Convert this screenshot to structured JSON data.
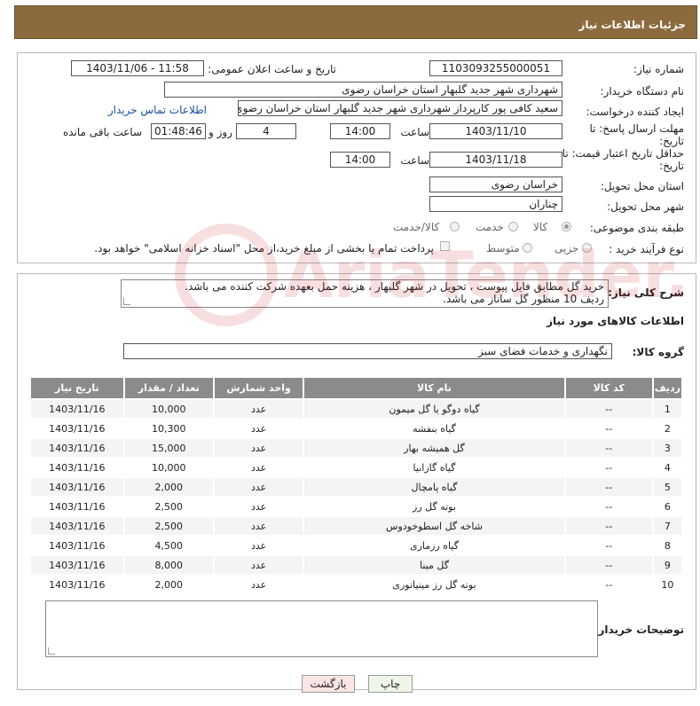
{
  "header": {
    "title": "جزئیات اطلاعات نیاز"
  },
  "form": {
    "need_number_label": "شماره نیاز:",
    "need_number": "1103093255000051",
    "announce_label": "تاریخ و ساعت اعلان عمومی:",
    "announce_value": "1403/11/06 - 11:58",
    "buyer_org_label": "نام دستگاه خریدار:",
    "buyer_org": "شهرداری شهر جدید گلبهار استان خراسان رضوی",
    "creator_label": "ایجاد کننده درخواست:",
    "creator": "سعید کافی پور کارپرداز شهرداری شهر جدید گلبهار استان خراسان رضوی",
    "contact_link": "اطلاعات تماس خریدار",
    "deadline_label": "مهلت ارسال پاسخ: تا تاریخ:",
    "deadline_date": "1403/11/10",
    "time_label": "ساعت",
    "deadline_time": "14:00",
    "days_value": "4",
    "days_label": "روز و",
    "remaining_time": "01:48:46",
    "remaining_label": "ساعت باقی مانده",
    "validity_label": "حداقل تاریخ اعتبار قیمت: تا تاریخ:",
    "validity_date": "1403/11/18",
    "validity_time": "14:00",
    "province_label": "استان محل تحویل:",
    "province": "خراسان رضوی",
    "city_label": "شهر محل تحویل:",
    "city": "چناران",
    "category_label": "طبقه بندی موضوعی:",
    "category_options": [
      "کالا",
      "خدمت",
      "کالا/خدمت"
    ],
    "process_label": "نوع فرآیند خرید :",
    "process_options": [
      "جزیی",
      "متوسط"
    ],
    "payment_note": "پرداخت تمام یا بخشی از مبلغ خرید،از محل \"اسناد خزانه اسلامی\" خواهد بود."
  },
  "description": {
    "label": "شرح کلی نیاز:",
    "line1": "خرید گل مطابق فایل پیوست ، تحویل در شهر گلبهار ، هزینه حمل بعهده شرکت کننده می باشد.",
    "line2": "ردیف 10 منظور گل ساناز می باشد."
  },
  "goods": {
    "section_title": "اطلاعات کالاهای مورد نیاز",
    "group_label": "گروه کالا:",
    "group_value": "نگهداری و خدمات فضای سبز",
    "columns": [
      "ردیف",
      "کد کالا",
      "نام کالا",
      "واحد شمارش",
      "تعداد / مقدار",
      "تاریخ نیاز"
    ],
    "rows": [
      {
        "row": "1",
        "code": "--",
        "name": "گیاه دوگو یا گل میمون",
        "unit": "عدد",
        "qty": "10,000",
        "date": "1403/11/16"
      },
      {
        "row": "2",
        "code": "--",
        "name": "گیاه بنفشه",
        "unit": "عدد",
        "qty": "10,300",
        "date": "1403/11/16"
      },
      {
        "row": "3",
        "code": "--",
        "name": "گل همیشه بهار",
        "unit": "عدد",
        "qty": "15,000",
        "date": "1403/11/16"
      },
      {
        "row": "4",
        "code": "--",
        "name": "گیاه گازانیا",
        "unit": "عدد",
        "qty": "10,000",
        "date": "1403/11/16"
      },
      {
        "row": "5",
        "code": "--",
        "name": "گیاه پامچال",
        "unit": "عدد",
        "qty": "2,000",
        "date": "1403/11/16"
      },
      {
        "row": "6",
        "code": "--",
        "name": "بوته گل رز",
        "unit": "عدد",
        "qty": "2,500",
        "date": "1403/11/16"
      },
      {
        "row": "7",
        "code": "--",
        "name": "شاخه گل اسطوخودوس",
        "unit": "عدد",
        "qty": "2,500",
        "date": "1403/11/16"
      },
      {
        "row": "8",
        "code": "--",
        "name": "گیاه رزماری",
        "unit": "عدد",
        "qty": "4,500",
        "date": "1403/11/16"
      },
      {
        "row": "9",
        "code": "--",
        "name": "گل مینا",
        "unit": "عدد",
        "qty": "8,000",
        "date": "1403/11/16"
      },
      {
        "row": "10",
        "code": "--",
        "name": "بوته گل رز مینیاتوری",
        "unit": "عدد",
        "qty": "2,000",
        "date": "1403/11/16"
      }
    ]
  },
  "buyer_notes": {
    "label": "توضیحات خریدار:",
    "value": ""
  },
  "buttons": {
    "print": "چاپ",
    "back": "بازگشت"
  },
  "watermark": {
    "text": "AriaTender.neT"
  },
  "colors": {
    "header": "#8b6b3e",
    "table_header": "#8b8b8b",
    "link": "#1a4fa0"
  }
}
